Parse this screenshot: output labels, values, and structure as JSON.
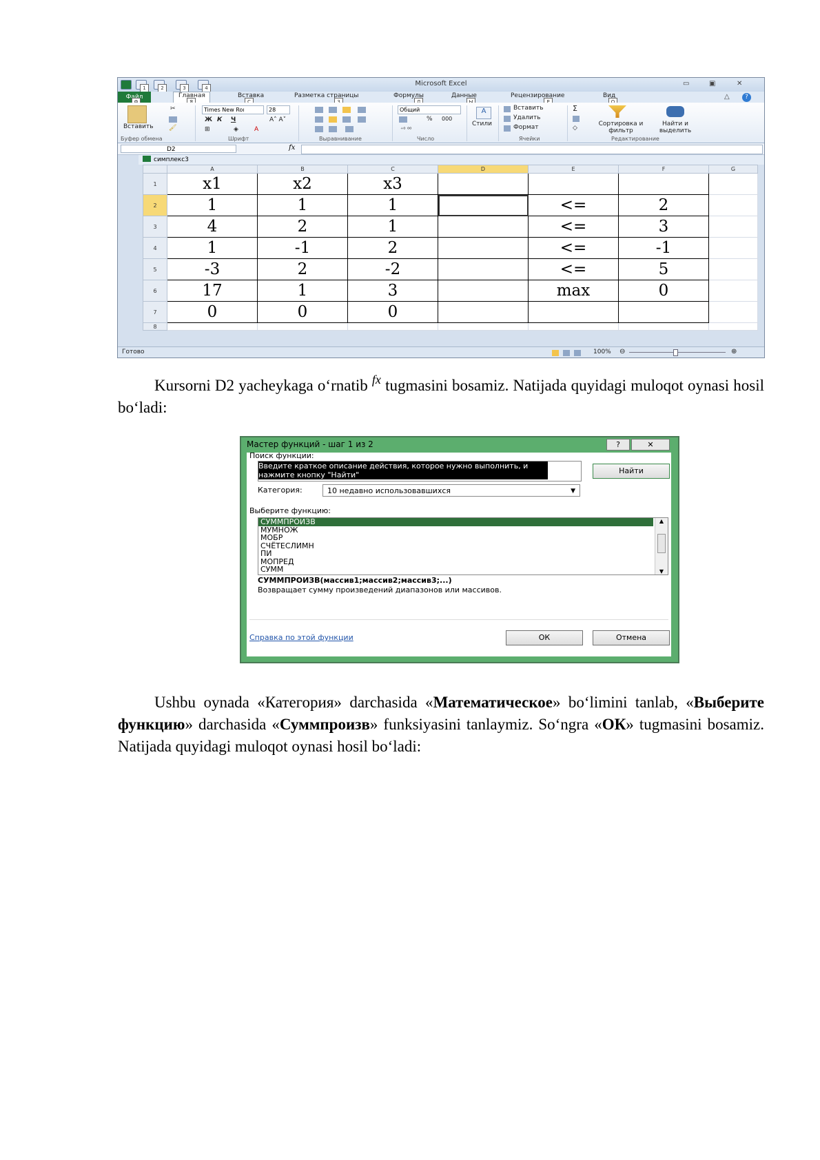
{
  "excel": {
    "window_title": "Microsoft Excel",
    "tabs": [
      "Файл",
      "Главная",
      "Вставка",
      "Разметка страницы",
      "Формулы",
      "Данные",
      "Рецензирование",
      "Вид"
    ],
    "tab_keytips": [
      "Ф",
      "Я",
      "С",
      "З",
      "Л",
      "Ы",
      "Р",
      "О"
    ],
    "qat_keytips": [
      "1",
      "2",
      "3",
      "4"
    ],
    "ribbon": {
      "paste": "Вставить",
      "clipboard": "Буфер обмена",
      "font_name": "Times New Roı",
      "font_size": "28",
      "font_group": "Шрифт",
      "bold": "Ж",
      "italic": "К",
      "underline": "Ч",
      "align_group": "Выравнивание",
      "number_format": "Общий",
      "percent": "%",
      "thousands": "000",
      "number_group": "Число",
      "styles": "Стили",
      "insert": "Вставить",
      "delete": "Удалить",
      "format": "Формат",
      "cells_group": "Ячейки",
      "sum": "Σ",
      "sort": "Сортировка и фильтр",
      "find": "Найти и выделить",
      "edit_group": "Редактирование"
    },
    "name_box": "D2",
    "fx": "fx",
    "workbook": "симплекс3",
    "columns": [
      "A",
      "B",
      "C",
      "D",
      "E",
      "F",
      "G"
    ],
    "rows": [
      {
        "n": "1",
        "cells": [
          "x1",
          "x2",
          "x3",
          "",
          "",
          "",
          ""
        ]
      },
      {
        "n": "2",
        "cells": [
          "1",
          "1",
          "1",
          "",
          "<=",
          "2",
          ""
        ]
      },
      {
        "n": "3",
        "cells": [
          "4",
          "2",
          "1",
          "",
          "<=",
          "3",
          ""
        ]
      },
      {
        "n": "4",
        "cells": [
          "1",
          "-1",
          "2",
          "",
          "<=",
          "-1",
          ""
        ]
      },
      {
        "n": "5",
        "cells": [
          "-3",
          "2",
          "-2",
          "",
          "<=",
          "5",
          ""
        ]
      },
      {
        "n": "6",
        "cells": [
          "17",
          "1",
          "3",
          "",
          "max",
          "0",
          ""
        ]
      },
      {
        "n": "7",
        "cells": [
          "0",
          "0",
          "0",
          "",
          "",
          "",
          ""
        ]
      },
      {
        "n": "8",
        "cells": [
          "",
          "",
          "",
          "",
          "",
          "",
          ""
        ]
      }
    ],
    "status": "Готово",
    "zoom": "100%"
  },
  "para1": {
    "a": "Kursorni D2 yacheykaga o‘rnatib",
    "fx": "fx",
    "b": "tugmasini bosamiz. Natijada quyidagi muloqot oynasi hosil bo‘ladi:"
  },
  "dialog": {
    "title": "Мастер функций - шаг 1 из 2",
    "help": "?",
    "close": "✕",
    "search_label": "Поиск функции:",
    "search_text": "Введите краткое описание действия, которое нужно выполнить, и нажмите кнопку \"Найти\"",
    "find_button": "Найти",
    "category_label": "Категория:",
    "category_value": "10 недавно использовавшихся",
    "choose_label": "Выберите функцию:",
    "functions": [
      "СУММПРОИЗВ",
      "МУМНОЖ",
      "МОБР",
      "СЧЁТЕСЛИМН",
      "ПИ",
      "МОПРЕД",
      "СУММ"
    ],
    "signature": "СУММПРОИЗВ(массив1;массив2;массив3;...)",
    "description": "Возвращает сумму произведений диапазонов или массивов.",
    "help_link": "Справка по этой функции",
    "ok": "ОК",
    "cancel": "Отмена"
  },
  "para2": {
    "t1": "Ushbu oynada «Категория» darchasida «",
    "b1": "Математическое",
    "t2": "» bo‘limini tanlab, «",
    "b2": "Выберите функцию",
    "t3": "» darchasida «",
    "b3": "Суммпроизв",
    "t4": "» funksiyasini tanlaymiz. So‘ngra «",
    "b4": "ОК",
    "t5": "» tugmasini bosamiz.  Natijada quyidagi muloqot oynasi hosil bo‘ladi:"
  }
}
